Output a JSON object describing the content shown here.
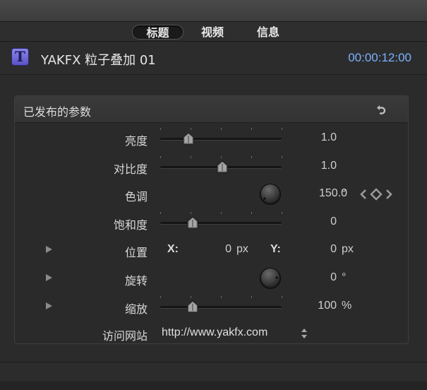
{
  "tabs": [
    {
      "label": "标题",
      "active": true
    },
    {
      "label": "视频",
      "active": false
    },
    {
      "label": "信息",
      "active": false
    }
  ],
  "header": {
    "icon": "T",
    "title": "YAKFX 粒子叠加 01",
    "timecode": "00:00:12:00"
  },
  "panel": {
    "title": "已发布的参数",
    "reset_icon": "undo-arrow-icon"
  },
  "params": {
    "brightness": {
      "label": "亮度",
      "value": "1.0",
      "slider_fraction": 0.23
    },
    "contrast": {
      "label": "对比度",
      "value": "1.0",
      "slider_fraction": 0.51
    },
    "hue": {
      "label": "色调",
      "value": "150.0",
      "unit": "°"
    },
    "saturation": {
      "label": "饱和度",
      "value": "0",
      "slider_fraction": 0.27
    },
    "position": {
      "label": "位置",
      "x_label": "X:",
      "x_value": "0",
      "x_unit": "px",
      "y_label": "Y:",
      "y_value": "0",
      "y_unit": "px"
    },
    "rotation": {
      "label": "旋转",
      "value": "0",
      "unit": "°"
    },
    "scale": {
      "label": "缩放",
      "value": "100",
      "unit": "%",
      "slider_fraction": 0.27
    },
    "website": {
      "label": "访问网站",
      "value": "http://www.yakfx.com"
    }
  },
  "colors": {
    "accent_timecode": "#7ab1ff",
    "icon_purple": "#6e68d8"
  }
}
